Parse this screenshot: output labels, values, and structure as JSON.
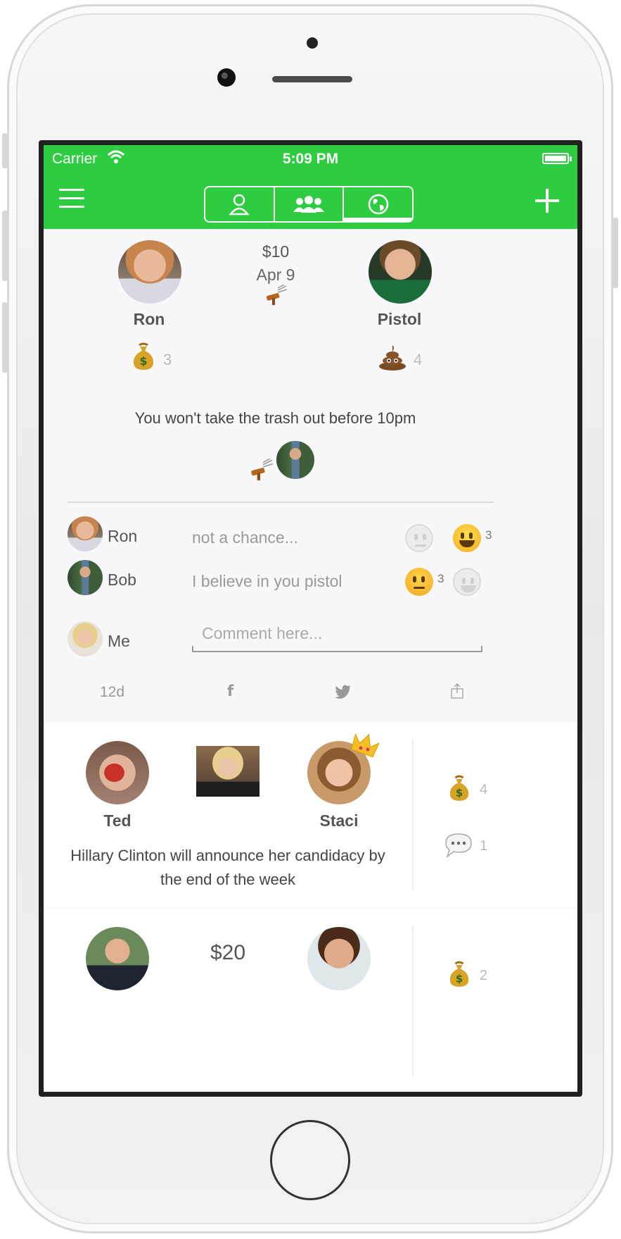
{
  "statusbar": {
    "carrier": "Carrier",
    "time": "5:09 PM"
  },
  "bet1": {
    "left_name": "Ron",
    "right_name": "Pistol",
    "amount": "$10",
    "date": "Apr 9",
    "left_reaction_count": "3",
    "right_reaction_count": "4",
    "statement": "You won't take the trash out before 10pm",
    "comments": [
      {
        "name": "Ron",
        "text": "not a chance...",
        "agree_count": "3"
      },
      {
        "name": "Bob",
        "text": "I believe in you pistol",
        "disagree_count": "3"
      }
    ],
    "me_label": "Me",
    "comment_placeholder": "Comment here...",
    "age": "12d",
    "facebook_glyph": "f"
  },
  "bet2": {
    "left_name": "Ted",
    "right_name": "Staci",
    "statement": "Hillary Clinton will announce her candidacy by the end of the week",
    "money_count": "4",
    "comment_count": "1"
  },
  "bet3": {
    "amount": "$20",
    "money_count": "2"
  },
  "colors": {
    "brand_green": "#2ecc40",
    "background": "#f8f8fa"
  },
  "icons": [
    "wifi-icon",
    "menu-icon",
    "person-icon",
    "group-icon",
    "globe-icon",
    "plus-icon",
    "gavel-icon",
    "money-bag-icon",
    "poop-icon",
    "facebook-icon",
    "twitter-icon",
    "share-icon",
    "speech-bubble-icon",
    "crown-icon"
  ]
}
